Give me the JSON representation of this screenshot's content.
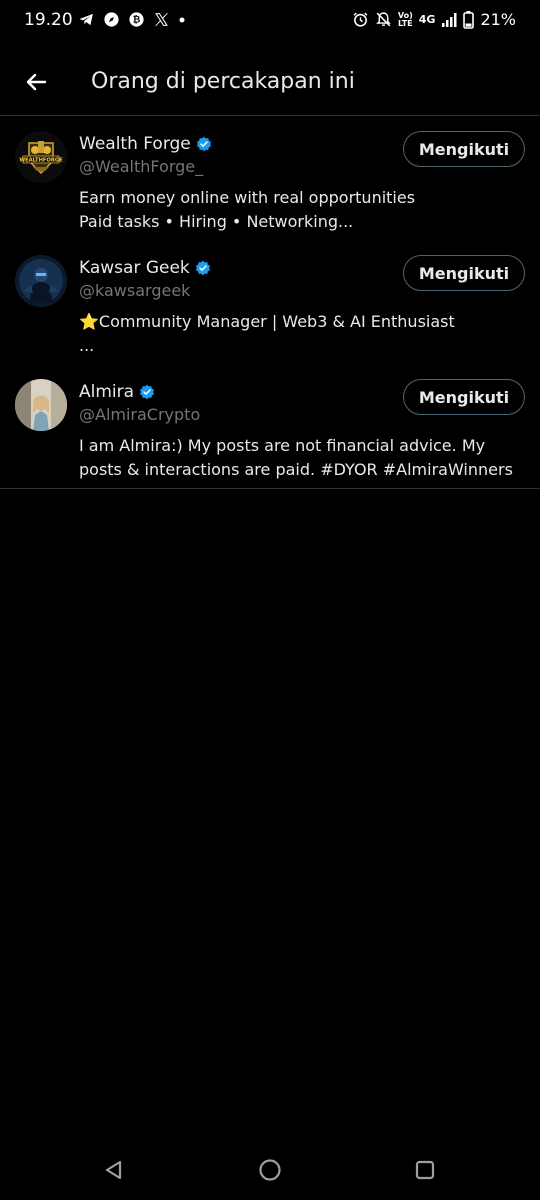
{
  "status_bar": {
    "time": "19.20",
    "network_top": "Vo)",
    "network_bottom": "LTE",
    "network_type": "4G",
    "battery": "21%",
    "left_icons": [
      "telegram-icon",
      "compass-icon",
      "bitcoin-icon",
      "x-logo-icon",
      "dot-icon"
    ],
    "right_icons": [
      "alarm-icon",
      "mute-icon",
      "signal-icon",
      "battery-icon"
    ]
  },
  "header": {
    "title": "Orang di percakapan ini",
    "back_icon": "arrow-left-icon"
  },
  "users": [
    {
      "name": "Wealth Forge",
      "handle": "@WealthForge_",
      "verified": true,
      "bio": "Earn money online with real opportunities\nPaid tasks • Hiring • Networking...",
      "follow_label": "Mengikuti",
      "avatar_text": "WEALTHFORGE"
    },
    {
      "name": "Kawsar Geek",
      "handle": "@kawsargeek",
      "verified": true,
      "bio": "⭐Community Manager | Web3 & AI Enthusiast\n...",
      "follow_label": "Mengikuti"
    },
    {
      "name": "Almira",
      "handle": "@AlmiraCrypto",
      "verified": true,
      "bio": "I am Almira:) My posts are not financial advice. My posts & interactions are paid. #DYOR #AlmiraWinners",
      "follow_label": "Mengikuti"
    }
  ],
  "colors": {
    "background": "#000000",
    "text_primary": "#e7e9ea",
    "text_secondary": "#71767b",
    "verified_blue": "#1d9bf0",
    "divider": "#2f3336"
  },
  "nav_bar": {
    "icons": [
      "back-triangle-icon",
      "home-circle-icon",
      "recents-square-icon"
    ]
  }
}
